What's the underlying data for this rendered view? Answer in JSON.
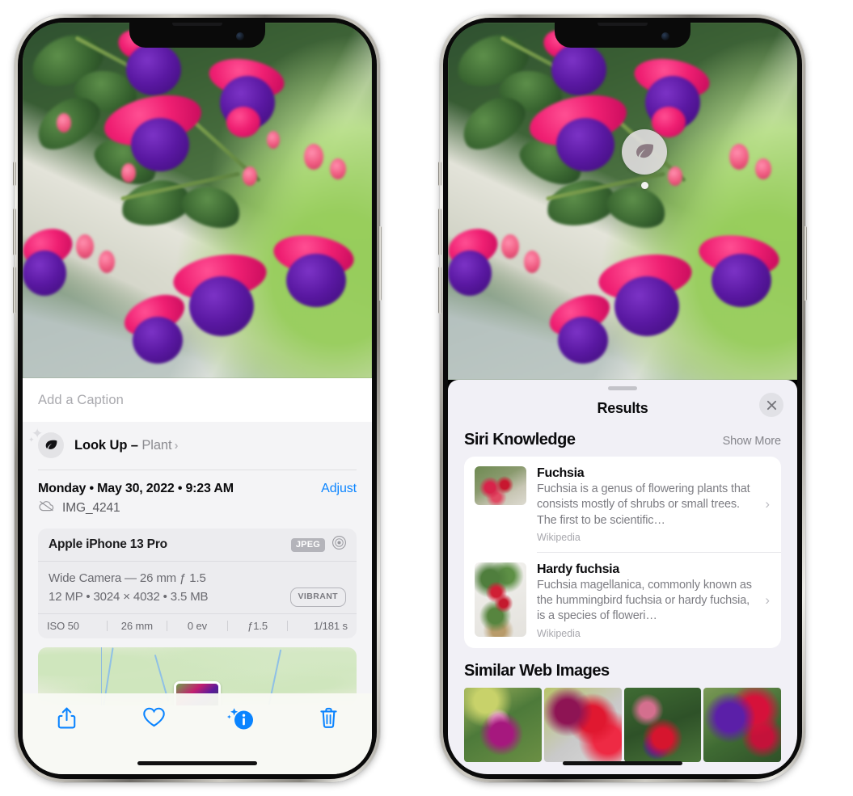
{
  "left_phone": {
    "photo": {
      "alt_name": "fuchsia-flowers-hanging-basket"
    },
    "caption": {
      "placeholder": "Add a Caption",
      "value": ""
    },
    "lookup": {
      "icon": "leaf-icon",
      "sparkle_icon": "sparkle-icon",
      "label": "Look Up – ",
      "subject": "Plant",
      "chevron": "›"
    },
    "meta": {
      "date": "Monday • May 30, 2022 • 9:23 AM",
      "adjust_label": "Adjust",
      "cloud_icon": "cloud-slash-icon",
      "filename": "IMG_4241"
    },
    "camera": {
      "model": "Apple iPhone 13 Pro",
      "format_badge": "JPEG",
      "aperture_icon": "aperture-icon",
      "lens_line": "Wide Camera — 26 mm ƒ 1.5",
      "specs_line": "12 MP • 3024 × 4032 • 3.5 MB",
      "style_badge": "VIBRANT",
      "exif": [
        "ISO 50",
        "26 mm",
        "0 ev",
        "ƒ1.5",
        "1/181 s"
      ]
    },
    "map": {
      "pin_icon": "photo-pin-thumbnail"
    },
    "toolbar": [
      {
        "name": "share-button",
        "icon": "share-icon"
      },
      {
        "name": "favorite-button",
        "icon": "heart-icon"
      },
      {
        "name": "info-button",
        "icon": "info-sparkle-icon"
      },
      {
        "name": "delete-button",
        "icon": "trash-icon"
      }
    ],
    "accent_color": "#0a84ff"
  },
  "right_phone": {
    "photo_badge": {
      "icon": "leaf-icon",
      "name": "visual-lookup-leaf-badge"
    },
    "sheet": {
      "grabber": "drag-handle",
      "title": "Results",
      "close_icon": "close-icon"
    },
    "siri_knowledge": {
      "section_title": "Siri Knowledge",
      "show_more": "Show More",
      "items": [
        {
          "title": "Fuchsia",
          "description": "Fuchsia is a genus of flowering plants that consists mostly of shrubs or small trees. The first to be scientific…",
          "source": "Wikipedia",
          "chevron": "›"
        },
        {
          "title": "Hardy fuchsia",
          "description": "Fuchsia magellanica, commonly known as the hummingbird fuchsia or hardy fuchsia, is a species of floweri…",
          "source": "Wikipedia",
          "chevron": "›"
        }
      ]
    },
    "similar_web_images": {
      "section_title": "Similar Web Images",
      "thumbnails": [
        "fuchsia-web-image-1",
        "fuchsia-web-image-2",
        "fuchsia-web-image-3",
        "fuchsia-web-image-4"
      ]
    }
  }
}
